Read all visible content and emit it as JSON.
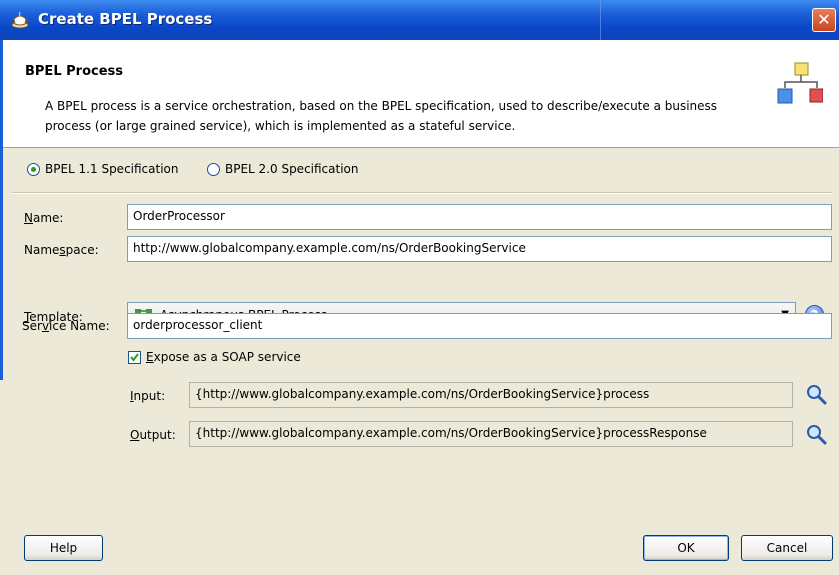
{
  "window": {
    "title": "Create BPEL Process",
    "close_glyph": "✕"
  },
  "header": {
    "title": "BPEL Process",
    "description": "A BPEL process is a service orchestration, based on the BPEL specification, used to describe/execute a business process (or large grained service), which is implemented as a stateful service."
  },
  "spec": {
    "options": [
      "BPEL 1.1 Specification",
      "BPEL 2.0 Specification"
    ],
    "selected": "BPEL 1.1 Specification"
  },
  "form": {
    "name": {
      "label_mnemonic": "N",
      "label_rest": "ame:",
      "value": "OrderProcessor"
    },
    "namespace": {
      "label_pre": "Name",
      "label_mnemonic": "s",
      "label_rest": "pace:",
      "value": "http://www.globalcompany.example.com/ns/OrderBookingService"
    },
    "template": {
      "label_mnemonic": "T",
      "label_rest": "emplate:",
      "value": "Asynchronous BPEL Process"
    },
    "service_name": {
      "label_pre": "Ser",
      "label_mnemonic": "v",
      "label_rest": "ice Name:",
      "value": "orderprocessor_client"
    },
    "expose_soap": {
      "label_mnemonic": "E",
      "label_rest": "xpose as a SOAP service",
      "checked": true
    },
    "input": {
      "label_mnemonic": "I",
      "label_rest": "nput:",
      "value": "{http://www.globalcompany.example.com/ns/OrderBookingService}process"
    },
    "output": {
      "label_mnemonic": "O",
      "label_rest": "utput:",
      "value": "{http://www.globalcompany.example.com/ns/OrderBookingService}processResponse"
    }
  },
  "buttons": {
    "help": "Help",
    "ok": "OK",
    "cancel": "Cancel"
  },
  "icons": {
    "app": "bpel-cup-icon",
    "header": "process-diagram-icon",
    "template": "async-process-icon",
    "help": "help-icon",
    "search": "search-icon",
    "dropdown": "chevron-down-icon"
  },
  "colors": {
    "titlebar": "#0a46c8",
    "dialog_bg": "#ece9d8",
    "accent": "#21a121"
  }
}
